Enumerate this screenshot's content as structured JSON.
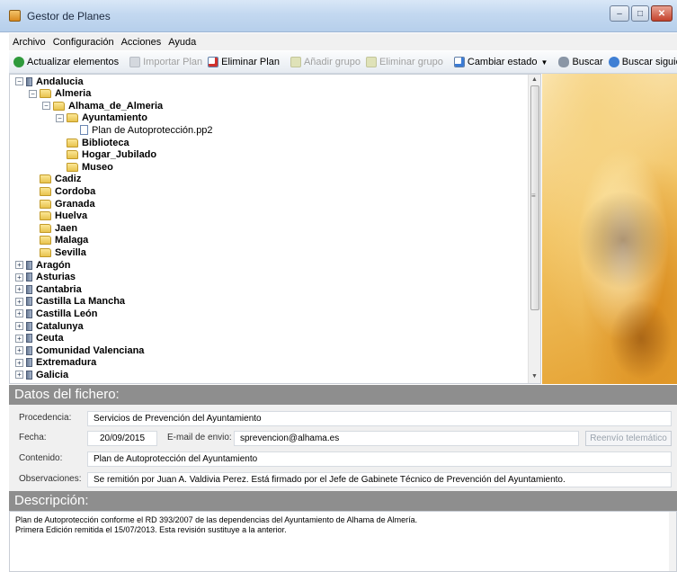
{
  "window": {
    "title": "Gestor de Planes"
  },
  "menu": [
    "Archivo",
    "Configuración",
    "Acciones",
    "Ayuda"
  ],
  "toolbar": {
    "refresh": "Actualizar elementos",
    "import": "Importar Plan",
    "delete_plan": "Eliminar Plan",
    "add_group": "Añadir grupo",
    "delete_group": "Eliminar grupo",
    "change_state": "Cambiar estado",
    "search": "Buscar",
    "search_next": "Buscar siguiente"
  },
  "tree": [
    {
      "label": "Andalucia",
      "level": 0,
      "icon": "book-icon",
      "exp": "-"
    },
    {
      "label": "Almeria",
      "level": 1,
      "icon": "folder-icon",
      "exp": "-"
    },
    {
      "label": "Alhama_de_Almeria",
      "level": 2,
      "icon": "folder-icon",
      "exp": "-"
    },
    {
      "label": "Ayuntamiento",
      "level": 3,
      "icon": "folder-icon",
      "exp": "-"
    },
    {
      "label": "Plan de Autoprotección.pp2",
      "level": 4,
      "icon": "file-icon",
      "exp": ""
    },
    {
      "label": "Biblioteca",
      "level": 3,
      "icon": "folder-icon",
      "exp": ""
    },
    {
      "label": "Hogar_Jubilado",
      "level": 3,
      "icon": "folder-icon",
      "exp": ""
    },
    {
      "label": "Museo",
      "level": 3,
      "icon": "folder-icon",
      "exp": ""
    },
    {
      "label": "Cadiz",
      "level": 1,
      "icon": "folder-icon",
      "exp": ""
    },
    {
      "label": "Cordoba",
      "level": 1,
      "icon": "folder-icon",
      "exp": ""
    },
    {
      "label": "Granada",
      "level": 1,
      "icon": "folder-icon",
      "exp": ""
    },
    {
      "label": "Huelva",
      "level": 1,
      "icon": "folder-icon",
      "exp": ""
    },
    {
      "label": "Jaen",
      "level": 1,
      "icon": "folder-icon",
      "exp": ""
    },
    {
      "label": "Malaga",
      "level": 1,
      "icon": "folder-icon",
      "exp": ""
    },
    {
      "label": "Sevilla",
      "level": 1,
      "icon": "folder-icon",
      "exp": ""
    },
    {
      "label": "Aragón",
      "level": 0,
      "icon": "book-icon",
      "exp": "+"
    },
    {
      "label": "Asturias",
      "level": 0,
      "icon": "book-icon",
      "exp": "+"
    },
    {
      "label": "Cantabria",
      "level": 0,
      "icon": "book-icon",
      "exp": "+"
    },
    {
      "label": "Castilla La Mancha",
      "level": 0,
      "icon": "book-icon",
      "exp": "+"
    },
    {
      "label": "Castilla León",
      "level": 0,
      "icon": "book-icon",
      "exp": "+"
    },
    {
      "label": "Catalunya",
      "level": 0,
      "icon": "book-icon",
      "exp": "+"
    },
    {
      "label": "Ceuta",
      "level": 0,
      "icon": "book-icon",
      "exp": "+"
    },
    {
      "label": "Comunidad Valenciana",
      "level": 0,
      "icon": "book-icon",
      "exp": "+"
    },
    {
      "label": "Extremadura",
      "level": 0,
      "icon": "book-icon",
      "exp": "+"
    },
    {
      "label": "Galicia",
      "level": 0,
      "icon": "book-icon",
      "exp": "+"
    }
  ],
  "file_section": {
    "title": "Datos del fichero:",
    "procedencia_label": "Procedencia:",
    "procedencia": "Servicios de Prevención del Ayuntamiento",
    "fecha_label": "Fecha:",
    "fecha": "20/09/2015",
    "email_label": "E-mail de envio:",
    "email": "sprevencion@alhama.es",
    "resend_button": "Reenvío telemático",
    "contenido_label": "Contenido:",
    "contenido": "Plan de Autoprotección del Ayuntamiento",
    "observaciones_label": "Observaciones:",
    "observaciones": "Se remitión por Juan A. Valdivia Perez. Está firmado por el Jefe de Gabinete Técnico de Prevención del Ayuntamiento."
  },
  "description_section": {
    "title": "Descripción:",
    "line1": "Plan de Autoprotección conforme el RD 393/2007 de las dependencias del Ayuntamiento de Alhama de Almería.",
    "line2": "Primera Edición remitida el 15/07/2013. Esta revisión sustituye a la anterior."
  }
}
